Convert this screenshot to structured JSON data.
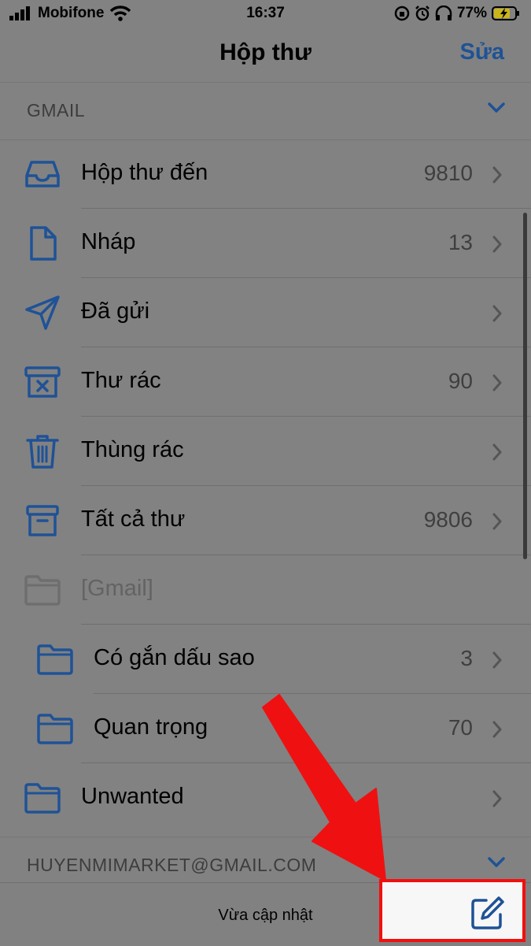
{
  "status_bar": {
    "carrier": "Mobifone",
    "time": "16:37",
    "battery": "77%"
  },
  "nav": {
    "title": "Hộp thư",
    "edit_label": "Sửa"
  },
  "sections": [
    {
      "label": "GMAIL"
    },
    {
      "label": "HUYENMIMARKET@GMAIL.COM"
    }
  ],
  "mailboxes": [
    {
      "label": "Hộp thư đến",
      "count": "9810",
      "icon": "inbox-icon"
    },
    {
      "label": "Nháp",
      "count": "13",
      "icon": "draft-icon"
    },
    {
      "label": "Đã gửi",
      "count": "",
      "icon": "sent-icon"
    },
    {
      "label": "Thư rác",
      "count": "90",
      "icon": "junk-icon"
    },
    {
      "label": "Thùng rác",
      "count": "",
      "icon": "trash-icon"
    },
    {
      "label": "Tất cả thư",
      "count": "9806",
      "icon": "archive-icon"
    },
    {
      "label": "[Gmail]",
      "count": "",
      "icon": "folder-icon"
    },
    {
      "label": "Có gắn dấu sao",
      "count": "3",
      "icon": "folder-icon"
    },
    {
      "label": "Quan trọng",
      "count": "70",
      "icon": "folder-icon"
    },
    {
      "label": "Unwanted",
      "count": "",
      "icon": "folder-icon"
    }
  ],
  "bottom_bar": {
    "status": "Vừa cập nhật",
    "compose_icon": "compose-icon"
  },
  "colors": {
    "accent": "#1f5296",
    "overlay_bg": "#828282",
    "highlight": "#f20f0f"
  }
}
